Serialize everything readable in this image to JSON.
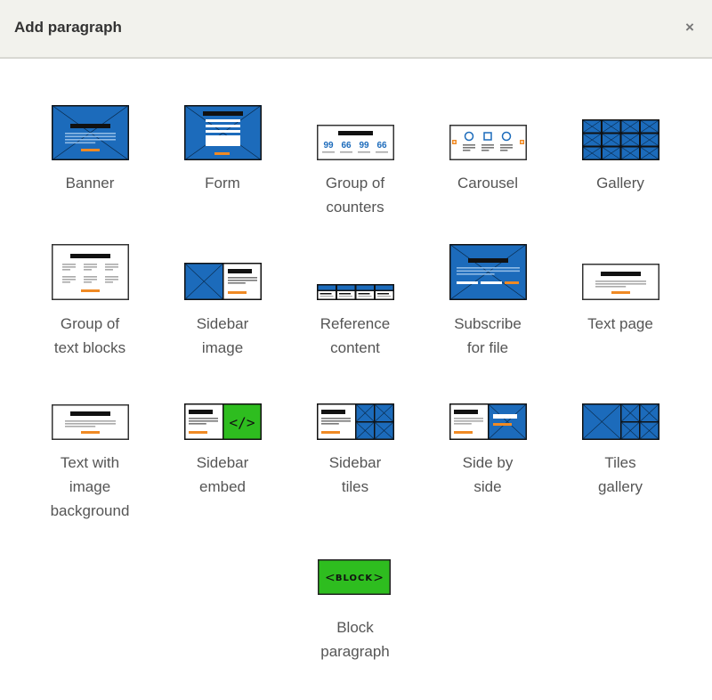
{
  "dialog": {
    "title": "Add paragraph",
    "close_label": "×"
  },
  "colors": {
    "blue": "#1c6bbb",
    "orange": "#f08a24",
    "green": "#2ebd1f",
    "dark": "#111111",
    "gray_line": "#aaaaaa"
  },
  "items": [
    {
      "id": "banner",
      "label": "Banner",
      "icon": "banner-icon"
    },
    {
      "id": "form",
      "label": "Form",
      "icon": "form-icon"
    },
    {
      "id": "group-of-counters",
      "label": "Group of\ncounters",
      "icon": "counters-icon",
      "counters": [
        "99",
        "66",
        "99",
        "66"
      ]
    },
    {
      "id": "carousel",
      "label": "Carousel",
      "icon": "carousel-icon"
    },
    {
      "id": "gallery",
      "label": "Gallery",
      "icon": "gallery-icon"
    },
    {
      "id": "group-of-text-blocks",
      "label": "Group of\ntext blocks",
      "icon": "text-blocks-icon"
    },
    {
      "id": "sidebar-image",
      "label": "Sidebar\nimage",
      "icon": "sidebar-image-icon"
    },
    {
      "id": "reference-content",
      "label": "Reference\ncontent",
      "icon": "reference-content-icon"
    },
    {
      "id": "subscribe-for-file",
      "label": "Subscribe\nfor file",
      "icon": "subscribe-icon"
    },
    {
      "id": "text-page",
      "label": "Text page",
      "icon": "text-page-icon"
    },
    {
      "id": "text-with-image-background",
      "label": "Text with\nimage\nbackground",
      "icon": "text-image-bg-icon"
    },
    {
      "id": "sidebar-embed",
      "label": "Sidebar\nembed",
      "icon": "sidebar-embed-icon",
      "embed_glyph": "</>"
    },
    {
      "id": "sidebar-tiles",
      "label": "Sidebar\ntiles",
      "icon": "sidebar-tiles-icon"
    },
    {
      "id": "side-by-side",
      "label": "Side by\nside",
      "icon": "side-by-side-icon"
    },
    {
      "id": "tiles-gallery",
      "label": "Tiles\ngallery",
      "icon": "tiles-gallery-icon"
    },
    {
      "id": "block-paragraph",
      "label": "Block\nparagraph",
      "icon": "block-icon",
      "block_text": "BLOCK"
    }
  ]
}
